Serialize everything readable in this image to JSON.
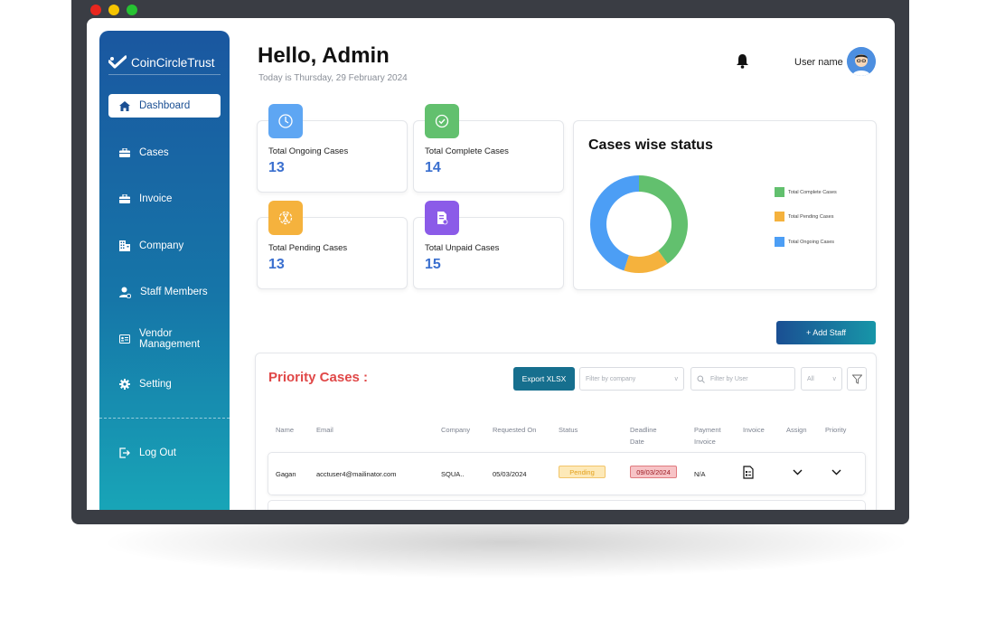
{
  "brand": {
    "name": "CoinCircleTrust"
  },
  "sidebar": {
    "items": [
      {
        "label": "Dashboard",
        "icon": "home-icon"
      },
      {
        "label": "Cases",
        "icon": "briefcase-icon"
      },
      {
        "label": "Invoice",
        "icon": "briefcase-icon"
      },
      {
        "label": "Company",
        "icon": "building-icon"
      },
      {
        "label": "Staff Members",
        "icon": "user-icon"
      },
      {
        "label": "Vendor Management",
        "label_line1": "Vendor",
        "label_line2": "Management",
        "icon": "id-card-icon"
      },
      {
        "label": "Setting",
        "icon": "gear-icon"
      }
    ],
    "logout": "Log Out"
  },
  "header": {
    "greeting": "Hello, Admin",
    "today": "Today is Thursday, 29 February 2024",
    "username": "User name"
  },
  "stats": [
    {
      "label": "Total Ongoing Cases",
      "value": "13",
      "color": "#5ea6f3"
    },
    {
      "label": "Total Complete Cases",
      "value": "14",
      "color": "#62c06e"
    },
    {
      "label": "Total Pending Cases",
      "value": "13",
      "color": "#f5b23d"
    },
    {
      "label": "Total Unpaid Cases",
      "value": "15",
      "color": "#8b5be8"
    }
  ],
  "chart_data": {
    "type": "pie",
    "title": "Cases wise status",
    "categories": [
      "Total Complete Cases",
      "Total Pending Cases",
      "Total Ongoing Cases"
    ],
    "values": [
      40,
      15,
      45
    ],
    "colors": [
      "#62c06e",
      "#f5b23d",
      "#4c9ef5"
    ],
    "legend": "right"
  },
  "actions": {
    "add_staff": "+ Add Staff",
    "export": "Export XLSX"
  },
  "filters": {
    "company_placeholder": "Filter by company",
    "user_placeholder": "Filter by User",
    "all_label": "All"
  },
  "priority": {
    "title": "Priority Cases :",
    "headers": {
      "name": "Name",
      "email": "Email",
      "company": "Company",
      "requested": "Requested On",
      "status": "Status",
      "deadline_1": "Deadline",
      "deadline_2": "Date",
      "payment_1": "Payment",
      "payment_2": "Invoice",
      "invoice": "Invoice",
      "assign": "Assign",
      "priority": "Priority"
    },
    "rows": [
      {
        "name": "Gagan",
        "email": "acctuser4@mailinator.com",
        "company": "SQUA..",
        "requested": "05/03/2024",
        "status": "Pending",
        "deadline": "09/03/2024",
        "payment": "N/A"
      }
    ]
  }
}
